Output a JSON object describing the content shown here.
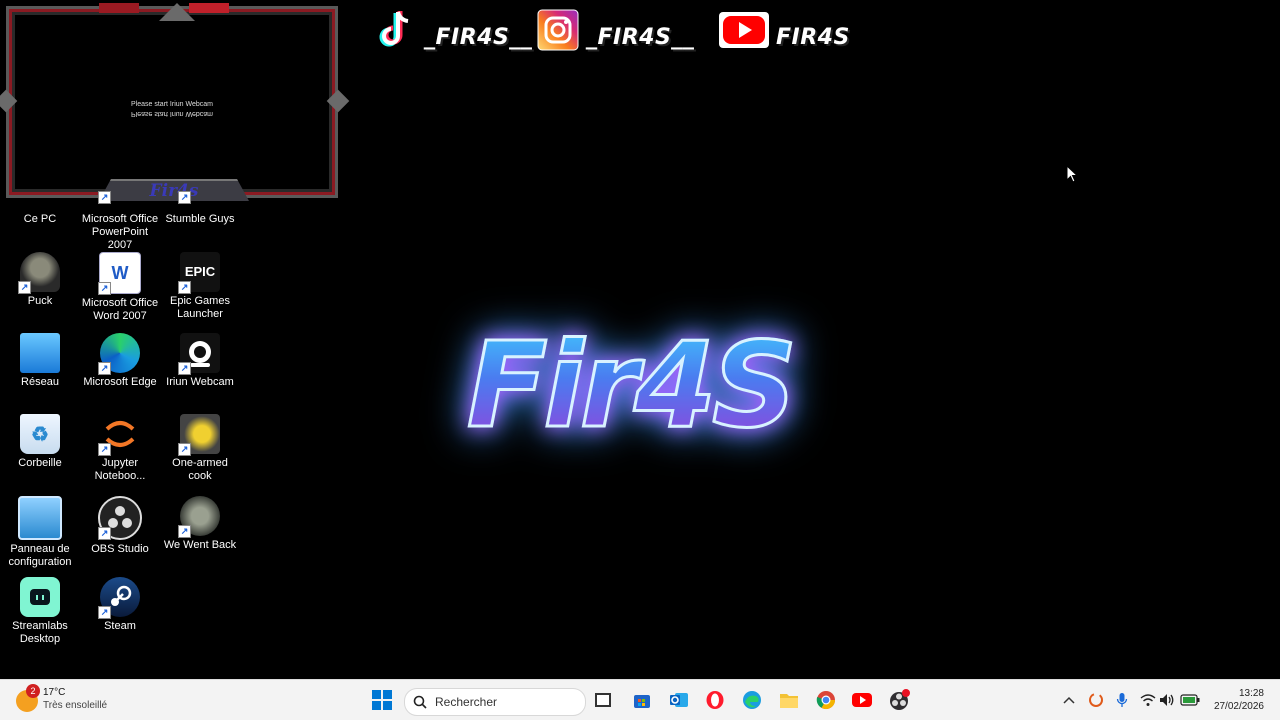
{
  "webcam": {
    "message": "Please start Iriun Webcam",
    "banner": "Fir4s"
  },
  "socials": [
    {
      "platform": "tiktok",
      "icon": "tiktok-icon",
      "handle": "_FIR4S__"
    },
    {
      "platform": "instagram",
      "icon": "instagram-icon",
      "handle": "_FIR4S__"
    },
    {
      "platform": "youtube",
      "icon": "youtube-icon",
      "handle": "FIR4S"
    }
  ],
  "logo_text": "Fir4S",
  "desktop_icons": [
    {
      "label": "Ce PC",
      "icon": "computer-icon"
    },
    {
      "label": "Microsoft Office PowerPoint 2007",
      "icon": "powerpoint-icon"
    },
    {
      "label": "Stumble Guys",
      "icon": "stumble-guys-icon"
    },
    {
      "label": "Puck",
      "icon": "puck-icon"
    },
    {
      "label": "Microsoft Office Word 2007",
      "icon": "word-icon"
    },
    {
      "label": "Epic Games Launcher",
      "icon": "epic-games-icon",
      "glyph": "EPIC"
    },
    {
      "label": "Réseau",
      "icon": "network-icon"
    },
    {
      "label": "Microsoft Edge",
      "icon": "edge-icon"
    },
    {
      "label": "Iriun Webcam",
      "icon": "iriun-webcam-icon"
    },
    {
      "label": "Corbeille",
      "icon": "recycle-bin-icon"
    },
    {
      "label": "Jupyter Noteboo...",
      "icon": "jupyter-icon"
    },
    {
      "label": "One-armed cook",
      "icon": "one-armed-cook-icon"
    },
    {
      "label": "Panneau de configuration",
      "icon": "control-panel-icon"
    },
    {
      "label": "OBS Studio",
      "icon": "obs-icon"
    },
    {
      "label": "We Went Back",
      "icon": "we-went-back-icon"
    },
    {
      "label": "Streamlabs Desktop",
      "icon": "streamlabs-icon"
    },
    {
      "label": "Steam",
      "icon": "steam-icon"
    }
  ],
  "taskbar": {
    "weather": {
      "badge": "2",
      "temp": "17°C",
      "condition": "Très ensoleillé"
    },
    "search_placeholder": "Rechercher",
    "apps": [
      "start-icon",
      "task-view-icon",
      "store-icon",
      "outlook-icon",
      "opera-icon",
      "edge-icon",
      "file-explorer-icon",
      "chrome-icon",
      "youtube-icon",
      "obs-icon"
    ],
    "clock": {
      "time": "13:28",
      "date": "27/02/2026"
    }
  }
}
